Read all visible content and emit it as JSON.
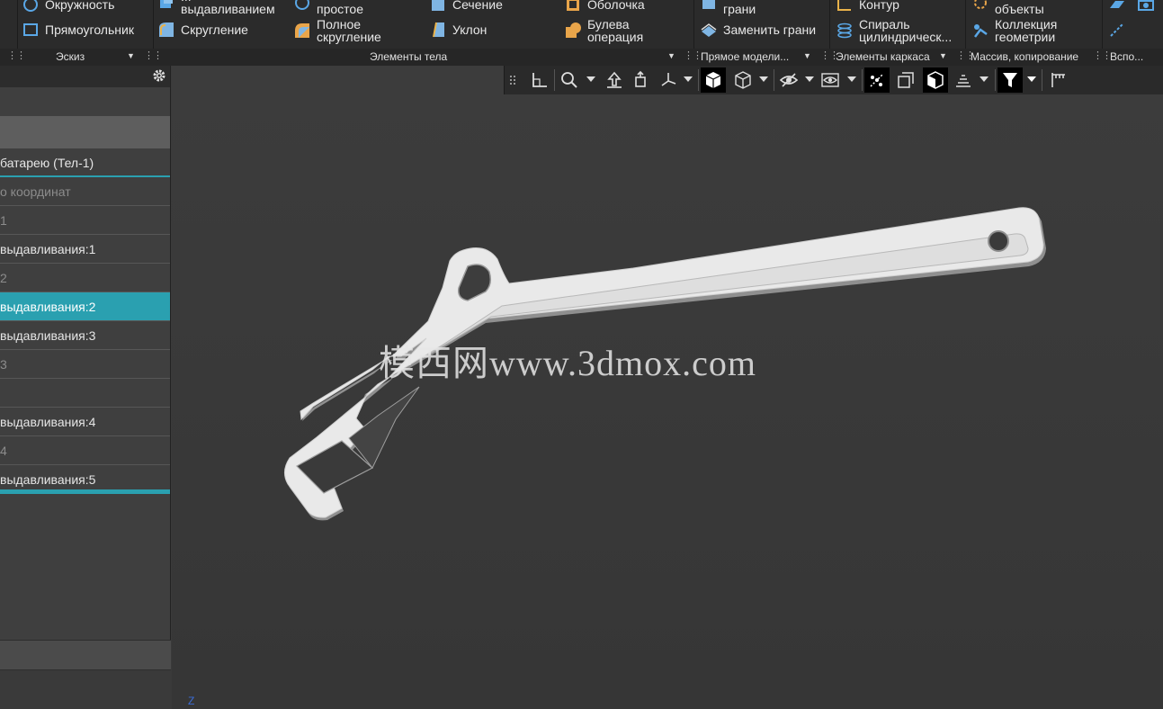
{
  "ribbon": {
    "tools": {
      "circle": "Окружность",
      "rectangle": "Прямоугольник",
      "extrude_line1": "...",
      "extrude_line2": "выдавливанием",
      "fillet": "Скругление",
      "simple_line2": "простое",
      "full_fillet_line1": "Полное",
      "full_fillet_line2": "скругление",
      "section": "Сечение",
      "draft": "Уклон",
      "shell": "Оболочка",
      "boolean_line1": "Булева",
      "boolean_line2": "операция",
      "faces_line2": "грани",
      "replace_faces": "Заменить грани",
      "contour": "Контур",
      "helix_line1": "Спираль",
      "helix_line2": "цилиндрическ...",
      "objects_line2": "объекты",
      "collection_line1": "Коллекция",
      "collection_line2": "геометрии"
    },
    "groups": {
      "sketch": "Эскиз",
      "body_elements": "Элементы тела",
      "direct_modeling": "Прямое модели...",
      "wireframe": "Элементы каркаса",
      "pattern": "Массив, копирование",
      "auxiliary": "Вспо..."
    }
  },
  "tree": {
    "items": [
      {
        "label": "батарею (Тел-1)",
        "state": "normal"
      },
      {
        "label": "о координат",
        "state": "dim"
      },
      {
        "label": "1",
        "state": "dim"
      },
      {
        "label": "выдавливания:1",
        "state": "normal"
      },
      {
        "label": "2",
        "state": "dim"
      },
      {
        "label": "выдавливания:2",
        "state": "selected"
      },
      {
        "label": "выдавливания:3",
        "state": "normal"
      },
      {
        "label": "3",
        "state": "dim"
      },
      {
        "label": "",
        "state": "normal"
      },
      {
        "label": "выдавливания:4",
        "state": "normal"
      },
      {
        "label": "4",
        "state": "dim"
      },
      {
        "label": "выдавливания:5",
        "state": "normal"
      }
    ]
  },
  "viewport": {
    "watermark": "模西网www.3dmox.com",
    "axis_label": "Z"
  },
  "colors": {
    "accent": "#2aa0b0",
    "ribbon_bg": "#2b2b2b",
    "viewport_bg": "#3a3a3a",
    "model_fill": "#e9e9e9"
  }
}
